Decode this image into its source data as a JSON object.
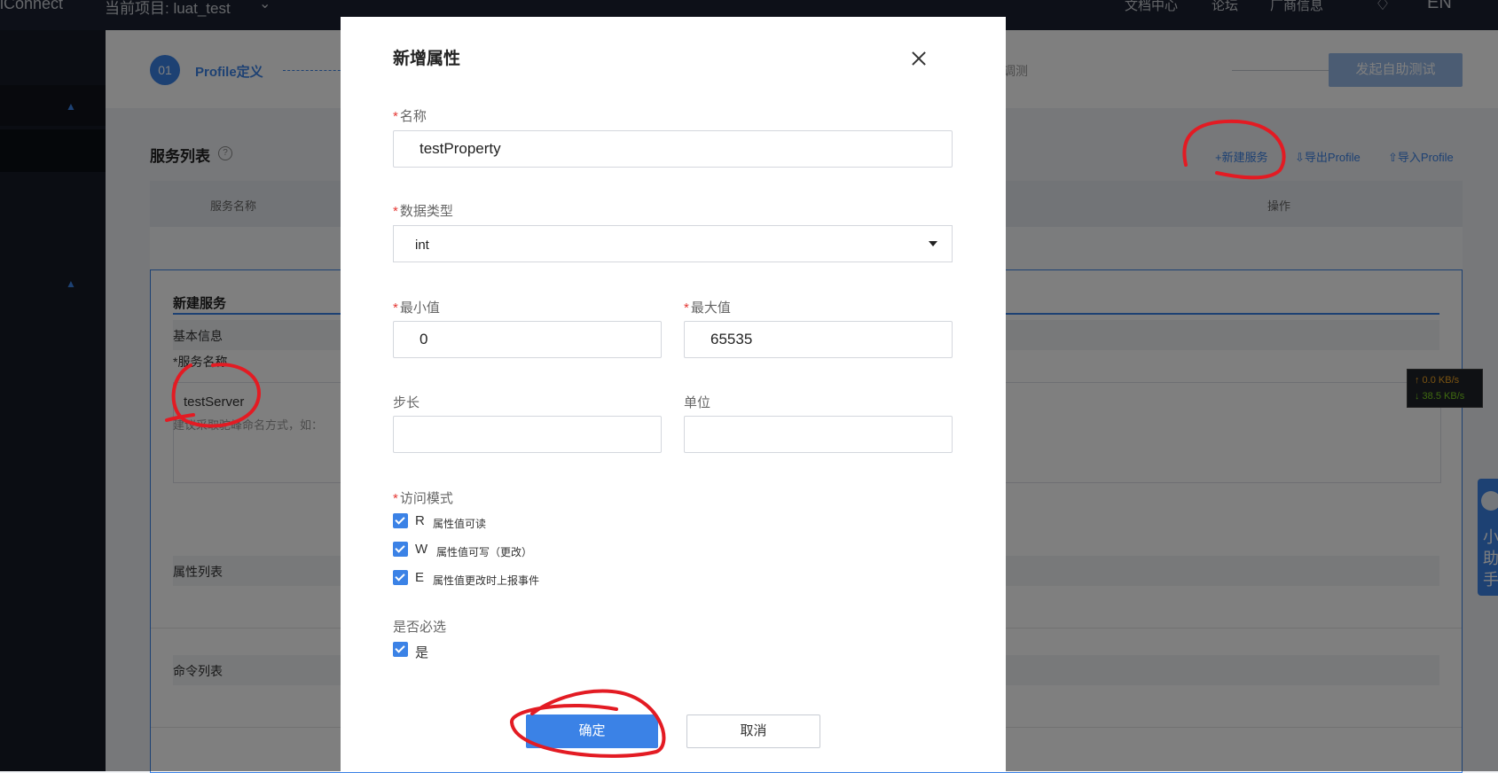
{
  "topbar": {
    "brand": "iConnect",
    "project": "当前项目:  luat_test",
    "links": [
      "文档中心",
      "论坛",
      "厂商信息",
      "EN"
    ]
  },
  "steps": {
    "num": "01",
    "label": "Profile定义",
    "faint": "调测",
    "self_test_button": "发起自助测试"
  },
  "services": {
    "title": "服务列表",
    "help": "?",
    "new_service": "+新建服务",
    "export": "⇩导出Profile",
    "import": "⇧导入Profile",
    "col_name": "服务名称",
    "col_ops": "操作"
  },
  "new_service": {
    "title": "新建服务",
    "basic_info": "基本信息",
    "name_label": "*服务名称",
    "name_value": "testServer",
    "hint": "建议采取驼峰命名方式，如：",
    "property_list": "属性列表",
    "command_list": "命令列表"
  },
  "modal": {
    "title": "新增属性",
    "name_label": "名称",
    "name_value": "testProperty",
    "type_label": "数据类型",
    "type_value": "int",
    "min_label": "最小值",
    "min_value": "0",
    "max_label": "最大值",
    "max_value": "65535",
    "step_label": "步长",
    "unit_label": "单位",
    "access_label": "访问模式",
    "access": [
      {
        "letter": "R",
        "desc": "属性值可读"
      },
      {
        "letter": "W",
        "desc": "属性值可写（更改）"
      },
      {
        "letter": "E",
        "desc": "属性值更改时上报事件"
      }
    ],
    "required_label": "是否必选",
    "required_value": "是",
    "ok": "确定",
    "cancel": "取消"
  },
  "net_speed": {
    "up": "↑ 0.0 KB/s",
    "down": "↓ 38.5 KB/s"
  },
  "side_helper": [
    "小",
    "助",
    "手"
  ],
  "colors": {
    "accent": "#3b82e6",
    "annotation": "#e31b23"
  }
}
